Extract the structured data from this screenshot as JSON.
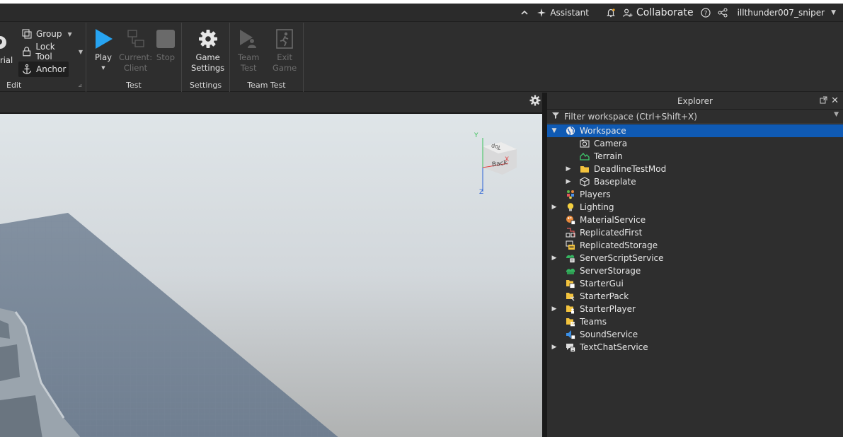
{
  "topbar": {
    "assistant": "Assistant",
    "collaborate": "Collaborate",
    "username": "illthunder007_sniper"
  },
  "ribbon": {
    "partial_label": "rial",
    "group_btn": "Group",
    "lock_tool_btn": "Lock Tool",
    "anchor_btn": "Anchor",
    "edit_group_label": "Edit",
    "play_btn": "Play",
    "current_client_btn_line1": "Current:",
    "current_client_btn_line2": "Client",
    "stop_btn": "Stop",
    "test_group_label": "Test",
    "game_settings_line1": "Game",
    "game_settings_line2": "Settings",
    "settings_group_label": "Settings",
    "team_test_line1": "Team",
    "team_test_line2": "Test",
    "exit_game_line1": "Exit",
    "exit_game_line2": "Game",
    "team_test_group_label": "Team Test"
  },
  "viewcube": {
    "face_top": "Top",
    "face_back": "Back",
    "axis_x": "X",
    "axis_y": "Y",
    "axis_z": "Z"
  },
  "explorer": {
    "title": "Explorer",
    "filter_placeholder": "Filter workspace (Ctrl+Shift+X)",
    "items": [
      {
        "label": "Workspace",
        "depth": 0,
        "arrow": "expanded",
        "icon": "globe-icon",
        "selected": true
      },
      {
        "label": "Camera",
        "depth": 1,
        "arrow": "none",
        "icon": "camera-icon"
      },
      {
        "label": "Terrain",
        "depth": 1,
        "arrow": "none",
        "icon": "terrain-icon"
      },
      {
        "label": "DeadlineTestMod",
        "depth": 1,
        "arrow": "collapsed",
        "icon": "folder-icon"
      },
      {
        "label": "Baseplate",
        "depth": 1,
        "arrow": "collapsed",
        "icon": "part-icon"
      },
      {
        "label": "Players",
        "depth": 0,
        "arrow": "none",
        "icon": "players-icon"
      },
      {
        "label": "Lighting",
        "depth": 0,
        "arrow": "collapsed",
        "icon": "lightbulb-icon"
      },
      {
        "label": "MaterialService",
        "depth": 0,
        "arrow": "none",
        "icon": "material-service-icon"
      },
      {
        "label": "ReplicatedFirst",
        "depth": 0,
        "arrow": "none",
        "icon": "replicated-first-icon"
      },
      {
        "label": "ReplicatedStorage",
        "depth": 0,
        "arrow": "none",
        "icon": "replicated-storage-icon"
      },
      {
        "label": "ServerScriptService",
        "depth": 0,
        "arrow": "collapsed",
        "icon": "server-script-service-icon"
      },
      {
        "label": "ServerStorage",
        "depth": 0,
        "arrow": "none",
        "icon": "server-storage-icon"
      },
      {
        "label": "StarterGui",
        "depth": 0,
        "arrow": "none",
        "icon": "starter-gui-icon"
      },
      {
        "label": "StarterPack",
        "depth": 0,
        "arrow": "none",
        "icon": "starter-pack-icon"
      },
      {
        "label": "StarterPlayer",
        "depth": 0,
        "arrow": "collapsed",
        "icon": "starter-player-icon"
      },
      {
        "label": "Teams",
        "depth": 0,
        "arrow": "none",
        "icon": "teams-icon"
      },
      {
        "label": "SoundService",
        "depth": 0,
        "arrow": "none",
        "icon": "sound-service-icon"
      },
      {
        "label": "TextChatService",
        "depth": 0,
        "arrow": "collapsed",
        "icon": "text-chat-service-icon"
      }
    ]
  }
}
